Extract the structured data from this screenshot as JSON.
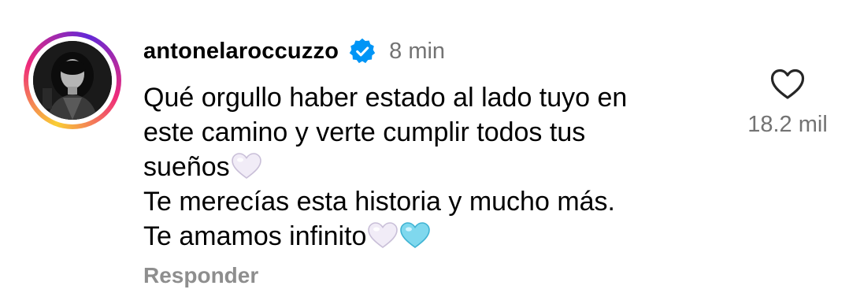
{
  "comment": {
    "username": "antonelaroccuzzo",
    "verified_icon": "verified-badge-icon",
    "time": "8 min",
    "lines": [
      "Qué orgullo haber estado al lado tuyo en",
      "este camino y verte cumplir todos tus",
      "sueños",
      "Te merecías esta historia y mucho más.",
      "Te amamos infinito"
    ],
    "emojis": {
      "line_3": [
        "white-heart-emoji"
      ],
      "line_5": [
        "white-heart-emoji",
        "light-blue-heart-emoji"
      ]
    },
    "reply_label": "Responder",
    "like_icon": "heart-outline-icon",
    "like_count": "18.2 mil"
  },
  "colors": {
    "verified_blue": "#0095f6",
    "secondary_text": "#737373",
    "reply_text": "#8e8e8e",
    "story_ring": [
      "#f9ce34",
      "#ee2a7b",
      "#6228d7"
    ],
    "white_heart": "#f1ecf7",
    "light_blue_heart": "#7fd8ee"
  }
}
